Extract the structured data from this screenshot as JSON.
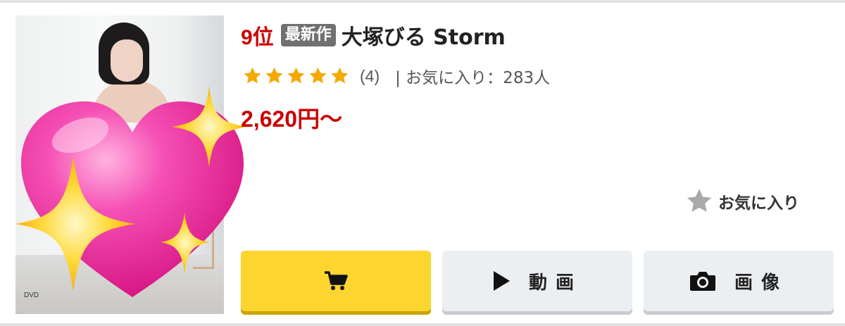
{
  "product": {
    "rank": "9位",
    "badge": "最新作",
    "title": "大塚びる Storm",
    "rating_stars": 5,
    "review_count": "(4)",
    "favorites_text": "| お気に入り：283人",
    "price": "2,620円〜",
    "thumbnail_caption": "DVD"
  },
  "actions": {
    "favorite_label": "お気に入り",
    "cart_icon": "cart-icon",
    "video_label": "動画",
    "image_label": "画像"
  },
  "colors": {
    "rank_red": "#cc0000",
    "star_gold": "#f5a800",
    "cart_yellow": "#fcd52f",
    "button_gray": "#eceff2",
    "badge_gray": "#707070",
    "heart_pink": "#f02fa0"
  }
}
